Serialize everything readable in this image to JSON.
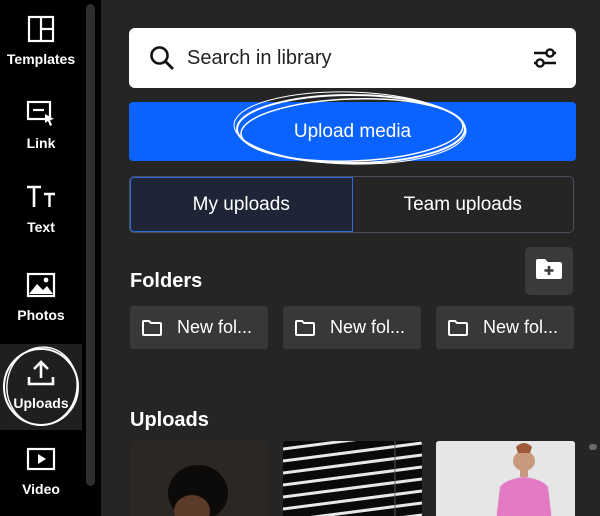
{
  "sidebar": {
    "items": [
      {
        "label": "Templates",
        "icon": "templates-icon"
      },
      {
        "label": "Link",
        "icon": "link-icon"
      },
      {
        "label": "Text",
        "icon": "text-icon"
      },
      {
        "label": "Photos",
        "icon": "photos-icon"
      },
      {
        "label": "Uploads",
        "icon": "upload-icon",
        "active": true
      },
      {
        "label": "Video",
        "icon": "video-icon"
      }
    ]
  },
  "search": {
    "placeholder": "Search in library"
  },
  "upload_button": {
    "label": "Upload media"
  },
  "tabs": [
    {
      "label": "My uploads",
      "active": true
    },
    {
      "label": "Team uploads",
      "active": false
    }
  ],
  "folders": {
    "title": "Folders",
    "items": [
      {
        "name": "New fol..."
      },
      {
        "name": "New fol..."
      },
      {
        "name": "New fol..."
      }
    ]
  },
  "uploads": {
    "title": "Uploads"
  },
  "colors": {
    "accent": "#0a62ff",
    "panel": "#252525",
    "rail": "#000000"
  }
}
